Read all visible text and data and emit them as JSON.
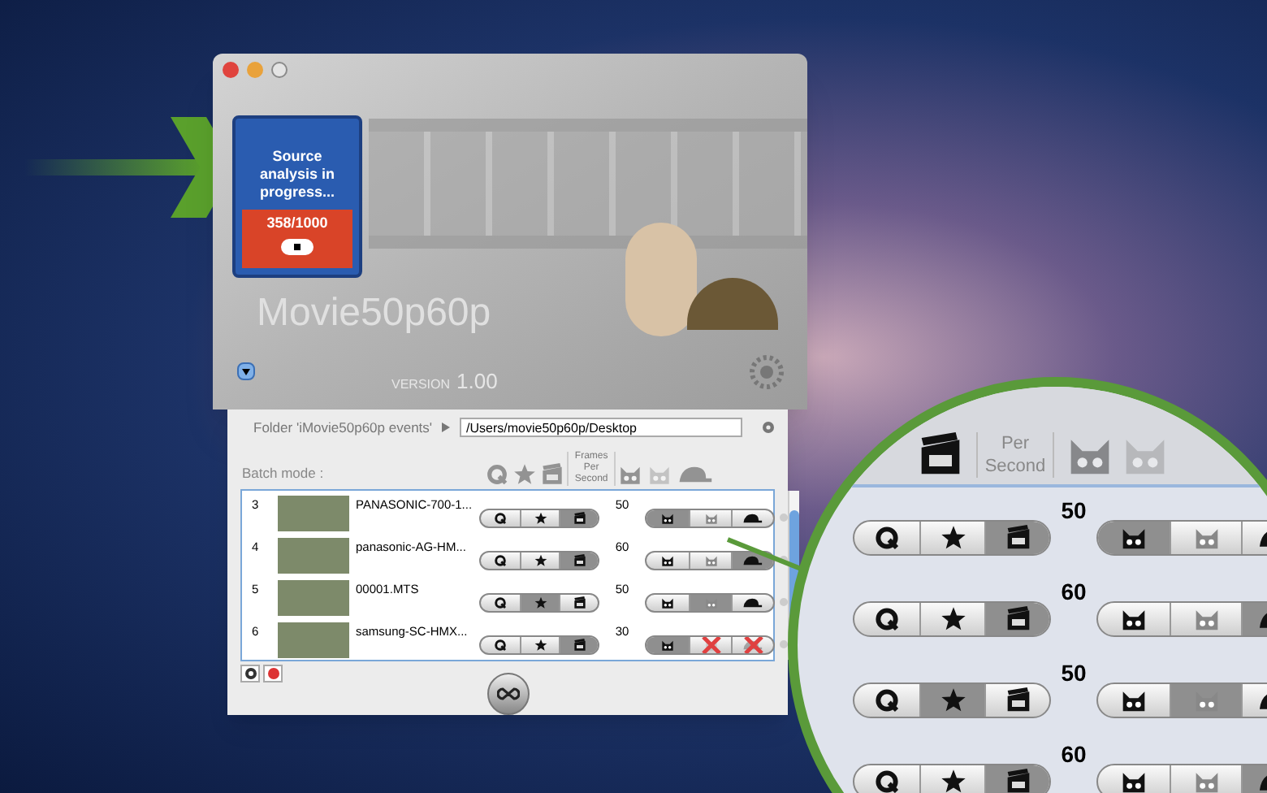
{
  "banner": {
    "card_status": "Source analysis in progress...",
    "counter": "358/1000",
    "app_name": "Movie50p60p",
    "version_label": "VERSION",
    "version": "1.00"
  },
  "folder": {
    "label": "Folder 'iMovie50p60p events'",
    "path": "/Users/movie50p60p/Desktop"
  },
  "batch": {
    "label": "Batch mode :",
    "fps_header": "Frames Per Second"
  },
  "rows": [
    {
      "index": "3",
      "name": "PANASONIC-700-1...",
      "fps": "50",
      "formats": [
        {
          "selected": false
        },
        {
          "selected": false
        },
        {
          "selected": true
        }
      ],
      "speeds": [
        {
          "selected": true,
          "disabled": false
        },
        {
          "selected": false,
          "disabled": false
        },
        {
          "selected": false,
          "disabled": false
        }
      ]
    },
    {
      "index": "4",
      "name": "panasonic-AG-HM...",
      "fps": "60",
      "formats": [
        {
          "selected": false
        },
        {
          "selected": false
        },
        {
          "selected": true
        }
      ],
      "speeds": [
        {
          "selected": false,
          "disabled": false
        },
        {
          "selected": false,
          "disabled": false
        },
        {
          "selected": true,
          "disabled": false
        }
      ]
    },
    {
      "index": "5",
      "name": "00001.MTS",
      "fps": "50",
      "formats": [
        {
          "selected": false
        },
        {
          "selected": true
        },
        {
          "selected": false
        }
      ],
      "speeds": [
        {
          "selected": false,
          "disabled": false
        },
        {
          "selected": true,
          "disabled": false
        },
        {
          "selected": false,
          "disabled": false
        }
      ]
    },
    {
      "index": "6",
      "name": "samsung-SC-HMX...",
      "fps": "30",
      "formats": [
        {
          "selected": false
        },
        {
          "selected": false
        },
        {
          "selected": true
        }
      ],
      "speeds": [
        {
          "selected": true,
          "disabled": false
        },
        {
          "selected": false,
          "disabled": true
        },
        {
          "selected": false,
          "disabled": true
        }
      ]
    }
  ],
  "magnifier": {
    "fps_header": "Per Second",
    "rows": [
      {
        "fps": "50",
        "formats": [
          {
            "selected": false
          },
          {
            "selected": false
          },
          {
            "selected": true
          }
        ],
        "speeds": [
          {
            "selected": true
          },
          {
            "selected": false
          },
          {
            "selected": false
          }
        ]
      },
      {
        "fps": "60",
        "formats": [
          {
            "selected": false
          },
          {
            "selected": false
          },
          {
            "selected": true
          }
        ],
        "speeds": [
          {
            "selected": false
          },
          {
            "selected": false
          },
          {
            "selected": true
          }
        ]
      },
      {
        "fps": "50",
        "formats": [
          {
            "selected": false
          },
          {
            "selected": true
          },
          {
            "selected": false
          }
        ],
        "speeds": [
          {
            "selected": false
          },
          {
            "selected": true
          },
          {
            "selected": false
          }
        ]
      },
      {
        "fps": "60",
        "formats": [
          {
            "selected": false
          },
          {
            "selected": false
          },
          {
            "selected": true
          }
        ],
        "speeds": [
          {
            "selected": false
          },
          {
            "selected": false
          },
          {
            "selected": true
          }
        ]
      }
    ]
  }
}
